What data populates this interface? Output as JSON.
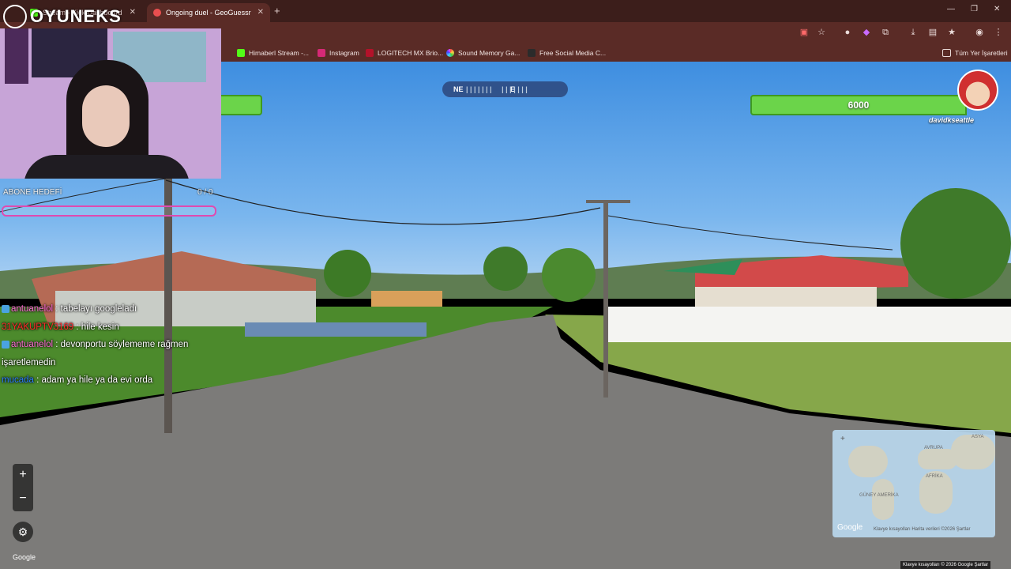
{
  "browser": {
    "tabs": [
      {
        "label": "Stream - Kick Dashboard"
      },
      {
        "label": "Ongoing duel - GeoGuessr"
      }
    ],
    "bookmarks": [
      {
        "label": "Himaberl Stream -..."
      },
      {
        "label": "Instagram"
      },
      {
        "label": "LOGITECH MX Brio..."
      },
      {
        "label": "Sound Memory Ga..."
      },
      {
        "label": "Free Social Media C..."
      }
    ],
    "all_bookmarks_label": "Tüm Yer İşaretleri"
  },
  "overlay": {
    "logo_text": "OYUNEKS",
    "sub_goal_label": "ABONE HEDEFİ",
    "sub_goal_count": "0 / 0"
  },
  "chat": [
    {
      "user": "antuanelol",
      "text": ": tabelayı googleladı"
    },
    {
      "user": "31YAKUPTV3169",
      "text": ": hile kesin"
    },
    {
      "user": "antuanelol",
      "text": ": devonportu söylememe rağmen işaretlemedin"
    },
    {
      "user": "mucada",
      "text": ": adam ya hile ya da evi orda"
    }
  ],
  "game": {
    "compass": {
      "left": "NE",
      "center": "E"
    },
    "opponent_health": "6000",
    "opponent_name": "davidkseattle"
  },
  "map": {
    "labels": [
      "ASYA",
      "AVRUPA",
      "AFRİKA",
      "GÜNEY AMERİKA"
    ],
    "google_label": "Google",
    "footer": "Klavye kısayolları   Harita verileri ©2026   Şartlar"
  },
  "attribution": "Klavye kısayolları  © 2026 Google  Şartlar",
  "google_small": "Google",
  "colors": {
    "health": "#6bd44a",
    "chrome": "#5a2b26",
    "sub_bar": "#e04ab0"
  }
}
